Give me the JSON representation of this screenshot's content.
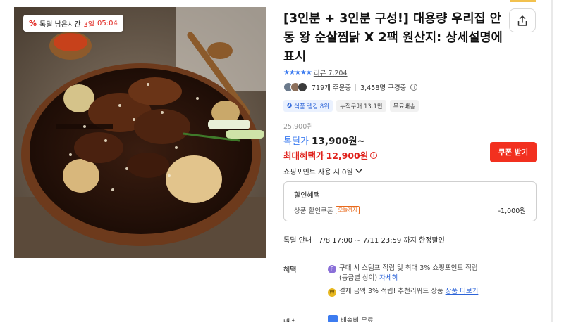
{
  "product": {
    "title": "[3인분 + 3인분 구성!] 대용량 우리집 안동 왕 순살찜닭 X 2팩 원산지: 상세설명에 표시"
  },
  "timer_badge": {
    "prefix": "톡딜 남은시간",
    "days": "3일",
    "time": "05:04"
  },
  "rating": {
    "stars": "★★★★★",
    "review_text": "리뷰 7,204"
  },
  "social": {
    "orders": "719개 주문중",
    "subscribers": "3,458명 구경중"
  },
  "tags": [
    "식품 랭킹 8위",
    "누적구매 13.1만",
    "무료배송"
  ],
  "price": {
    "original": "25,900원",
    "deal_label": "톡딜가",
    "deal_value": "13,900원~",
    "max_label": "최대혜택가",
    "max_value": "12,900원"
  },
  "coupon_button": "쿠폰 받기",
  "points": {
    "label": "쇼핑포인트 사용 시",
    "value": "0원"
  },
  "discount": {
    "header": "할인혜택",
    "item": "상품 할인쿠폰",
    "today_tag": "오늘까지",
    "amount": "-1,000원"
  },
  "deal_info": {
    "label": "톡딜 안내",
    "value": "7/8 17:00 ~ 7/11 23:59 까지 한정할인"
  },
  "benefits": {
    "label": "혜택",
    "line1": "구매 시 스탬프 적립 및 최대 3% 쇼핑포인트 적립",
    "line1b": "(등급별 상이)",
    "line1_link": "자세히",
    "line2": "결제 금액 3% 적립! 추천리워드 상품",
    "line2_link": "상품 더보기"
  },
  "shipping": {
    "label": "배송",
    "value": "배송비 무료"
  },
  "colors": {
    "accent_blue": "#3d7cf0",
    "sale_red": "#e0221c",
    "coupon_red": "#f2301f"
  }
}
